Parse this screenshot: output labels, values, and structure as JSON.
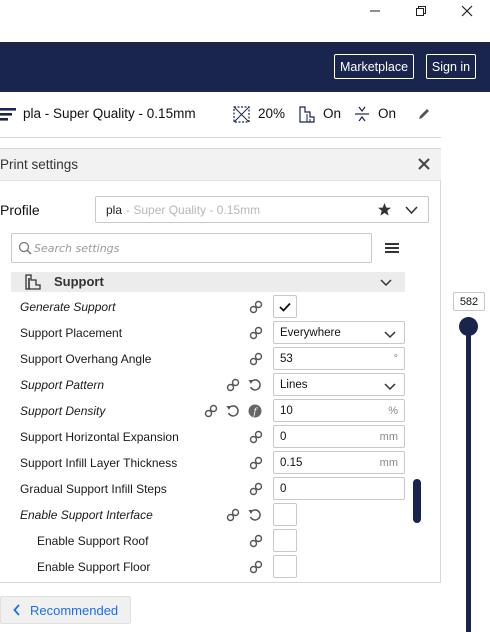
{
  "header": {
    "marketplace_label": "Marketplace",
    "signin_label": "Sign in"
  },
  "setup": {
    "profile_text": "pla - Super Quality - 0.15mm",
    "infill": "20%",
    "support": "On",
    "adhesion": "On"
  },
  "panel": {
    "title": "Print settings",
    "profile_label": "Profile",
    "profile_name": "pla",
    "profile_sub": "- Super Quality - 0.15mm",
    "search_placeholder": "Search settings",
    "category": "Support",
    "recommended_label": "Recommended"
  },
  "settings": [
    {
      "label": "Generate Support",
      "italic": true,
      "control": "checkbox",
      "checked": true
    },
    {
      "label": "Support Placement",
      "italic": false,
      "control": "select",
      "value": "Everywhere"
    },
    {
      "label": "Support Overhang Angle",
      "italic": false,
      "control": "input",
      "value": "53",
      "unit": "°"
    },
    {
      "label": "Support Pattern",
      "italic": true,
      "control": "select",
      "value": "Lines"
    },
    {
      "label": "Support Density",
      "italic": true,
      "control": "input",
      "value": "10",
      "unit": "%"
    },
    {
      "label": "Support Horizontal Expansion",
      "italic": false,
      "control": "input",
      "value": "0",
      "unit": "mm"
    },
    {
      "label": "Support Infill Layer Thickness",
      "italic": false,
      "control": "input",
      "value": "0.15",
      "unit": "mm"
    },
    {
      "label": "Gradual Support Infill Steps",
      "italic": false,
      "control": "input",
      "value": "0",
      "unit": ""
    },
    {
      "label": "Enable Support Interface",
      "italic": true,
      "control": "checkbox",
      "checked": false
    },
    {
      "label": "Enable Support Roof",
      "italic": false,
      "control": "checkbox",
      "checked": false
    },
    {
      "label": "Enable Support Floor",
      "italic": false,
      "control": "checkbox",
      "checked": false
    }
  ],
  "layer_slider": {
    "value": "582"
  },
  "colors": {
    "header_bg": "#19254c",
    "accent_blue": "#196ef0"
  }
}
